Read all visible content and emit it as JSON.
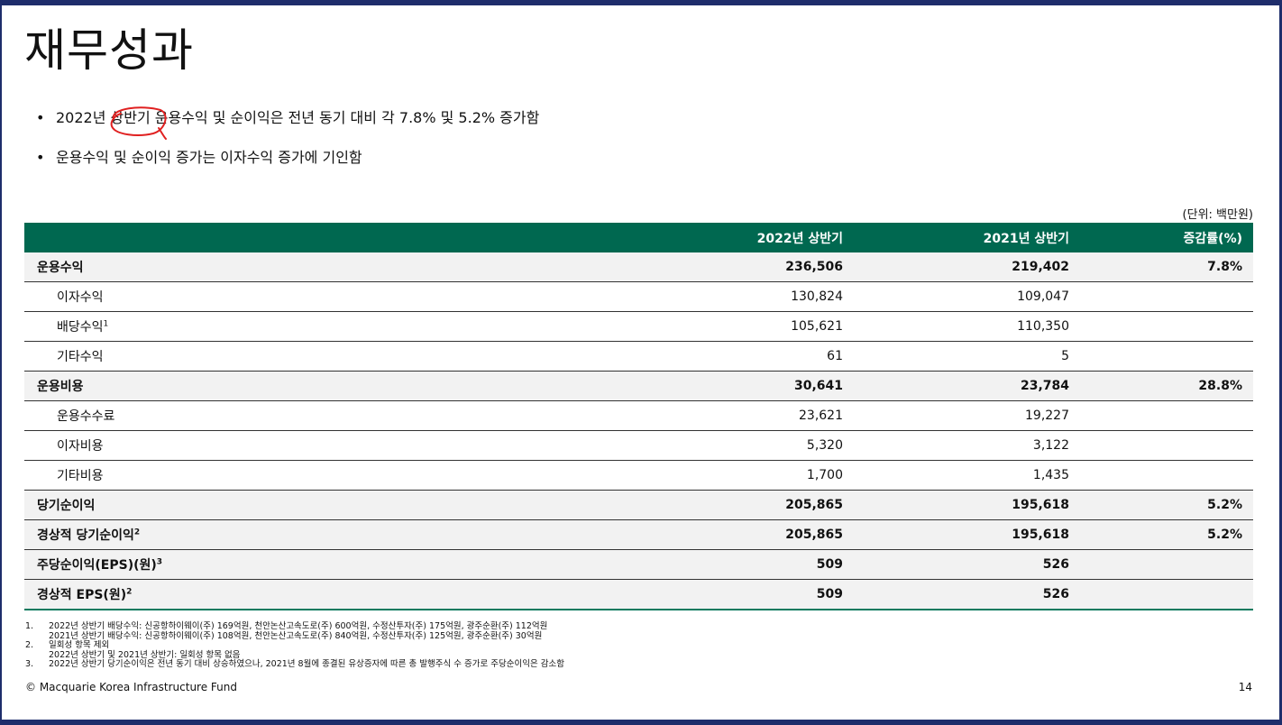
{
  "title": "재무성과",
  "bullets": [
    "2022년 상반기 운용수익 및 순이익은 전년 동기 대비 각 7.8% 및 5.2% 증가함",
    "운용수익 및 순이익 증가는 이자수익 증가에 기인함"
  ],
  "unit": "(단위: 백만원)",
  "table": {
    "headers": [
      "",
      "2022년 상반기",
      "2021년 상반기",
      "증감률(%)"
    ],
    "rows": [
      {
        "label": "운용수익",
        "sup": "",
        "v1": "236,506",
        "v2": "219,402",
        "v3": "7.8%"
      },
      {
        "label": "이자수익",
        "sup": "",
        "v1": "130,824",
        "v2": "109,047",
        "v3": ""
      },
      {
        "label": "배당수익",
        "sup": "1",
        "v1": "105,621",
        "v2": "110,350",
        "v3": ""
      },
      {
        "label": "기타수익",
        "sup": "",
        "v1": "61",
        "v2": "5",
        "v3": ""
      },
      {
        "label": "운용비용",
        "sup": "",
        "v1": "30,641",
        "v2": "23,784",
        "v3": "28.8%"
      },
      {
        "label": "운용수수료",
        "sup": "",
        "v1": "23,621",
        "v2": "19,227",
        "v3": ""
      },
      {
        "label": "이자비용",
        "sup": "",
        "v1": "5,320",
        "v2": "3,122",
        "v3": ""
      },
      {
        "label": "기타비용",
        "sup": "",
        "v1": "1,700",
        "v2": "1,435",
        "v3": ""
      },
      {
        "label": "당기순이익",
        "sup": "",
        "v1": "205,865",
        "v2": "195,618",
        "v3": "5.2%"
      },
      {
        "label": "경상적 당기순이익",
        "sup": "2",
        "v1": "205,865",
        "v2": "195,618",
        "v3": "5.2%"
      },
      {
        "label": "주당순이익(EPS)(원)",
        "sup": "3",
        "v1": "509",
        "v2": "526",
        "v3": ""
      },
      {
        "label": "경상적 EPS(원)",
        "sup": "2",
        "v1": "509",
        "v2": "526",
        "v3": ""
      }
    ]
  },
  "footnotes": [
    {
      "num": "1.",
      "text": "2022년 상반기 배당수익: 신공항하이웨이(주) 169억원, 천안논산고속도로(주) 600억원, 수정산투자(주) 175억원, 광주순환(주) 112억원"
    },
    {
      "num": "",
      "text": "2021년 상반기 배당수익: 신공항하이웨이(주) 108억원, 천안논산고속도로(주) 840억원, 수정산투자(주) 125억원, 광주순환(주) 30억원"
    },
    {
      "num": "2.",
      "text": "일회성 항목 제외"
    },
    {
      "num": "",
      "text": "2022년 상반기 및 2021년 상반기: 일회성 항목 없음"
    },
    {
      "num": "3.",
      "text": "2022년 상반기 당기순이익은 전년 동기 대비 상승하였으나, 2021년 8월에 종결된 유상증자에 따른 총 발행주식 수 증가로 주당순이익은 감소함"
    }
  ],
  "copyright": "© Macquarie Korea Infrastructure Fund",
  "page_number": "14",
  "colors": {
    "header_green": "#006850",
    "frame_navy": "#1e2d6b",
    "annotation_red": "#e02020"
  }
}
